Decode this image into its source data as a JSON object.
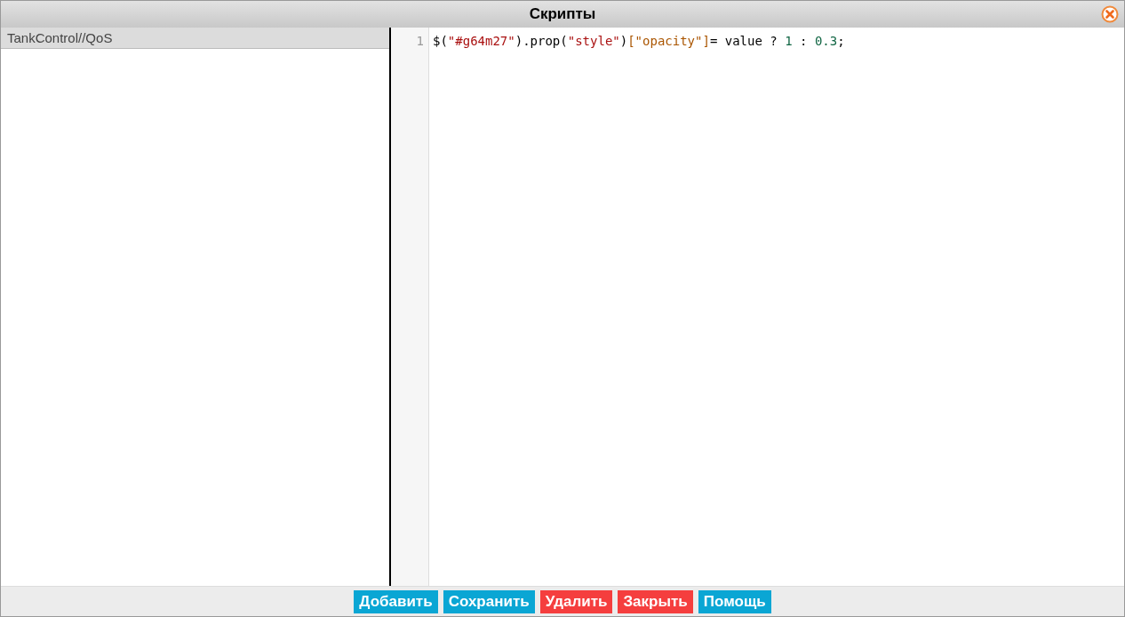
{
  "window": {
    "title": "Скрипты"
  },
  "scripts": [
    {
      "label": "TankControl//QoS",
      "selected": true
    }
  ],
  "editor": {
    "lines": [
      {
        "number": "1",
        "tokens": [
          {
            "kind": "plain",
            "text": "$("
          },
          {
            "kind": "string",
            "text": "\"#g64m27\""
          },
          {
            "kind": "plain",
            "text": ").prop("
          },
          {
            "kind": "string",
            "text": "\"style\""
          },
          {
            "kind": "plain",
            "text": ")"
          },
          {
            "kind": "property",
            "text": "[\"opacity\"]"
          },
          {
            "kind": "plain",
            "text": "= value ? "
          },
          {
            "kind": "number",
            "text": "1"
          },
          {
            "kind": "plain",
            "text": " : "
          },
          {
            "kind": "number",
            "text": "0.3"
          },
          {
            "kind": "plain",
            "text": ";"
          }
        ]
      }
    ]
  },
  "buttons": [
    {
      "label": "Добавить",
      "kind": "primary"
    },
    {
      "label": "Сохранить",
      "kind": "primary"
    },
    {
      "label": "Удалить",
      "kind": "danger"
    },
    {
      "label": "Закрыть",
      "kind": "danger"
    },
    {
      "label": "Помощь",
      "kind": "primary"
    }
  ]
}
